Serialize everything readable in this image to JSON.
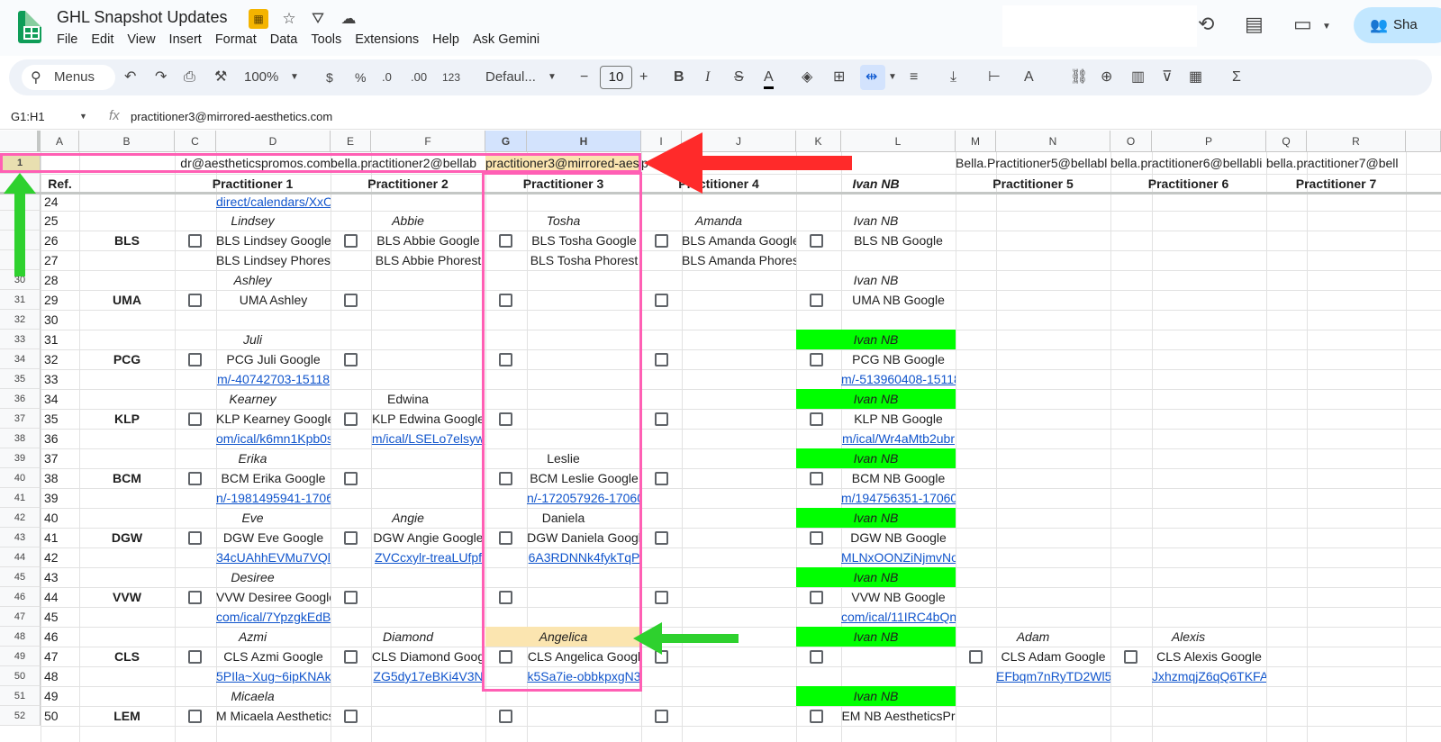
{
  "app": {
    "doc_title": "GHL Snapshot Updates",
    "menu": [
      "File",
      "Edit",
      "View",
      "Insert",
      "Format",
      "Data",
      "Tools",
      "Extensions",
      "Help",
      "Ask Gemini"
    ],
    "share_label": "Sha"
  },
  "toolbar": {
    "menus_label": "Menus",
    "zoom": "100%",
    "currency": "$",
    "percent": "%",
    "dec_decrease": ".0",
    "dec_increase": ".00",
    "number_format": "123",
    "font": "Defaul...",
    "font_size": "10",
    "minus": "−",
    "plus": "+",
    "bold": "B",
    "italic": "I",
    "strike": "S",
    "textcolor": "A",
    "sigma": "Σ"
  },
  "formula": {
    "name_box": "G1:H1",
    "fx": "fx",
    "value": "practitioner3@mirrored-aesthetics.com"
  },
  "grid": {
    "columns": [
      "A",
      "B",
      "C",
      "D",
      "E",
      "F",
      "G",
      "H",
      "I",
      "J",
      "K",
      "L",
      "M",
      "N",
      "O",
      "P",
      "Q",
      "R"
    ],
    "row_numbers": [
      "1",
      "2",
      "24",
      "25",
      "26",
      "27",
      "30",
      "31",
      "32",
      "33",
      "34",
      "35",
      "36",
      "37",
      "38",
      "39",
      "40",
      "41",
      "42",
      "43",
      "44",
      "45",
      "46",
      "47",
      "48",
      "49",
      "50",
      "51",
      "52"
    ],
    "row1": {
      "d": "dr@aestheticspromos.com",
      "e": "bella.practitioner2@bellab",
      "g": "practitioner3@mirrored-aes",
      "i": "p",
      "m": "Bella.Practitioner5@bellabl",
      "o": "bella.practitioner6@bellabli",
      "q": "bella.practitioner7@bell"
    },
    "row2": {
      "ref": "Ref.",
      "p1": "Practitioner 1",
      "p2": "Practitioner 2",
      "p3": "Practitioner 3",
      "p4": "Practitioner 4",
      "ivan": "Ivan NB",
      "p5": "Practitioner 5",
      "p6": "Practitioner 6",
      "p7": "Practitioner 7"
    },
    "ref_numbers": [
      "24",
      "25",
      "26",
      "27",
      "28",
      "29",
      "30",
      "31",
      "32",
      "33",
      "34",
      "35",
      "36",
      "37",
      "38",
      "39",
      "40",
      "41",
      "42",
      "43",
      "44",
      "45",
      "46",
      "47",
      "48",
      "49",
      "50"
    ],
    "link_row24": "direct/calendars/XxC",
    "groups": [
      {
        "code": "BLS",
        "p1": "Lindsey",
        "p1_google": "BLS Lindsey Google",
        "p1_3": "BLS Lindsey Phorest",
        "p2": "Abbie",
        "p2_google": "BLS Abbie Google",
        "p2_3": "BLS Abbie Phorest",
        "p3": "Tosha",
        "p3_google": "BLS Tosha Google",
        "p3_3": "BLS Tosha Phorest",
        "p4": "Amanda",
        "p4_google": "BLS Amanda Google",
        "p4_3": "BLS Amanda Phores",
        "nb": "Ivan NB",
        "nb_google": "BLS NB Google",
        "nb_3": ""
      },
      {
        "code": "UMA",
        "p1": "Ashley",
        "p1_google": "UMA Ashley",
        "p1_3": "",
        "p2": "",
        "p2_google": "",
        "p2_3": "",
        "p3": "",
        "p3_google": "",
        "p3_3": "",
        "p4": "",
        "p4_google": "",
        "p4_3": "",
        "nb": "Ivan NB",
        "nb_google": "UMA NB Google",
        "nb_3": ""
      },
      {
        "code": "PCG",
        "p1": "Juli",
        "p1_google": "PCG Juli Google",
        "p1_3": "m/-40742703-15118",
        "p2": "",
        "p2_google": "",
        "p2_3": "",
        "p3": "",
        "p3_google": "",
        "p3_3": "",
        "p4": "",
        "p4_google": "",
        "p4_3": "",
        "nb": "Ivan NB",
        "nb_google": "PCG NB Google",
        "nb_3": "m/-513960408-15118"
      },
      {
        "code": "KLP",
        "p1": "Kearney",
        "p1_google": "KLP Kearney Google",
        "p1_3": "om/ical/k6mn1Kpb0s",
        "p2": "Edwina",
        "p2_google": "KLP Edwina Google",
        "p2_3": "m/ical/LSELo7elsyw",
        "p3": "",
        "p3_google": "",
        "p3_3": "",
        "p4": "",
        "p4_google": "",
        "p4_3": "",
        "nb": "Ivan NB",
        "nb_google": "KLP NB Google",
        "nb_3": "m/ical/Wr4aMtb2ubr"
      },
      {
        "code": "BCM",
        "p1": "Erika",
        "p1_google": "BCM Erika Google",
        "p1_3": "n/-1981495941-1706",
        "p2": "",
        "p2_google": "",
        "p2_3": "",
        "p3": "Leslie",
        "p3_google": "BCM Leslie Google",
        "p3_3": "n/-172057926-17060",
        "p4": "",
        "p4_google": "",
        "p4_3": "",
        "nb": "Ivan NB",
        "nb_google": "BCM NB Google",
        "nb_3": "m/194756351-17060"
      },
      {
        "code": "DGW",
        "p1": "Eve",
        "p1_google": "DGW Eve Google",
        "p1_3": "34cUAhhEVMu7VQl",
        "p2": "Angie",
        "p2_google": "DGW Angie Google",
        "p2_3": "ZVCcxylr-treaLUfpf",
        "p3": "Daniela",
        "p3_google": "DGW Daniela Googl",
        "p3_3": "6A3RDNNk4fykTqP",
        "p4": "",
        "p4_google": "",
        "p4_3": "",
        "nb": "Ivan NB",
        "nb_google": "DGW NB Google",
        "nb_3": "MLNxOONZiNjmvNo"
      },
      {
        "code": "VVW",
        "p1": "Desiree",
        "p1_google": "VVW Desiree Google",
        "p1_3": "com/ical/7YpzgkEdB",
        "p2": "",
        "p2_google": "",
        "p2_3": "",
        "p3": "",
        "p3_google": "",
        "p3_3": "",
        "p4": "",
        "p4_google": "",
        "p4_3": "",
        "nb": "Ivan NB",
        "nb_google": "VVW NB Google",
        "nb_3": "com/ical/11IRC4bQn"
      },
      {
        "code": "CLS",
        "p1": "Azmi",
        "p1_google": "CLS Azmi Google",
        "p1_3": "5PIla~Xug~6ipKNAk",
        "p2": "Diamond",
        "p2_google": "CLS Diamond Goog",
        "p2_3": "ZG5dy17eBKi4V3N",
        "p3": "Angelica",
        "p3_google": "CLS Angelica Googl",
        "p3_3": "k5Sa7ie-obbkpxgN3",
        "p4": "",
        "p4_google": "",
        "p4_3": "",
        "nb": "Ivan NB",
        "nb_google": "",
        "nb_3": "",
        "p5": "Adam",
        "p5_google": "CLS Adam Google",
        "p5_3": "EFbqm7nRyTD2Wl5",
        "p6": "Alexis",
        "p6_google": "CLS Alexis Google",
        "p6_3": "JxhzmqjZ6qQ6TKFA"
      },
      {
        "code": "LEM",
        "p1": "Micaela",
        "p1_google": "M Micaela Aesthetics",
        "p1_3": "",
        "p2": "",
        "p2_google": "",
        "p2_3": "",
        "p3": "",
        "p3_google": "",
        "p3_3": "",
        "p4": "",
        "p4_google": "",
        "p4_3": "",
        "nb": "Ivan NB",
        "nb_google": "EM NB AestheticsPr",
        "nb_3": ""
      }
    ]
  },
  "colors": {
    "pink": "#ff5fb4",
    "red": "#ff2a2a",
    "green": "#00ff00",
    "arrow_green": "#2ed12e",
    "row1_highlight": "#fbe5b0"
  }
}
